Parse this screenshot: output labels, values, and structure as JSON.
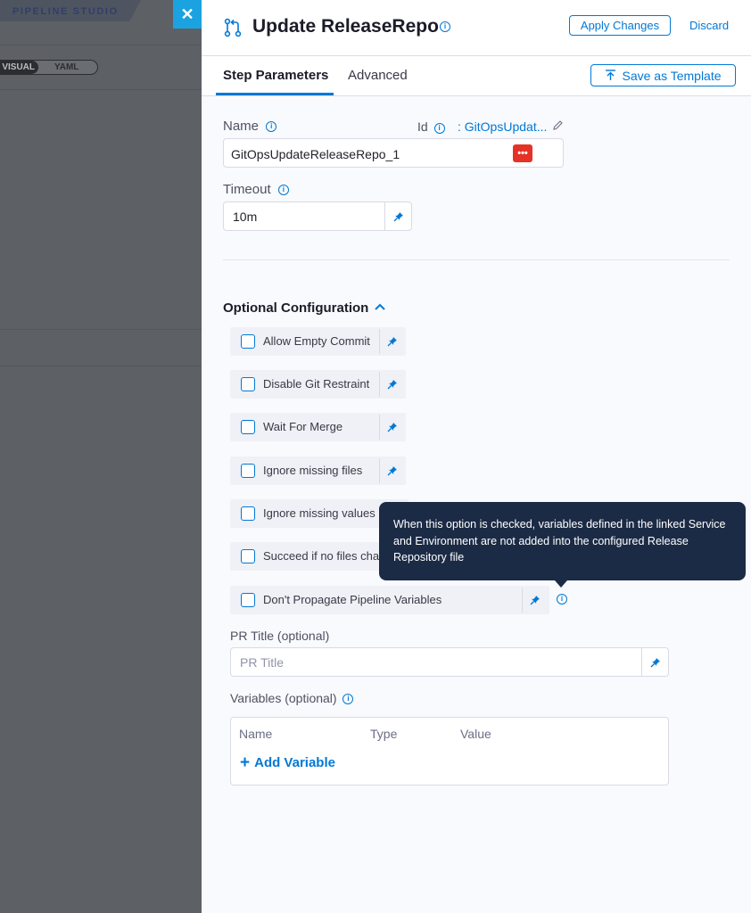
{
  "background": {
    "app_title": "PIPELINE STUDIO",
    "toggle_visual": "VISUAL",
    "toggle_yaml": "YAML"
  },
  "close_icon": "close-icon",
  "header": {
    "title": "Update ReleaseRepo",
    "apply_label": "Apply Changes",
    "discard_label": "Discard"
  },
  "tabs": {
    "items": [
      {
        "label": "Step Parameters",
        "active": true
      },
      {
        "label": "Advanced",
        "active": false
      }
    ],
    "save_template_label": "Save as Template"
  },
  "form": {
    "name_label": "Name",
    "id_label": "Id",
    "id_value": ": GitOpsUpdat...",
    "name_value": "GitOpsUpdateReleaseRepo_1",
    "timeout_label": "Timeout",
    "timeout_value": "10m"
  },
  "optional": {
    "title": "Optional Configuration",
    "checkboxes": [
      {
        "label": "Allow Empty Commit",
        "checked": false
      },
      {
        "label": "Disable Git Restraint",
        "checked": false
      },
      {
        "label": "Wait For Merge",
        "checked": false
      },
      {
        "label": "Ignore missing files",
        "checked": false
      },
      {
        "label": "Ignore missing values",
        "checked": false
      },
      {
        "label": "Succeed if no files cha",
        "checked": false
      },
      {
        "label": "Don't Propagate Pipeline Variables",
        "checked": false
      }
    ],
    "tooltip": "When this option is checked, variables defined in the linked Service and Environment are not added into the configured Release Repository file",
    "pr_title_label": "PR Title (optional)",
    "pr_title_placeholder": "PR Title",
    "variables_label": "Variables (optional)",
    "variables_columns": [
      "Name",
      "Type",
      "Value"
    ],
    "add_variable_label": "Add Variable"
  },
  "colors": {
    "accent": "#0278d5",
    "tooltip_bg": "#1c2b45",
    "close_bg": "#1aa3e0",
    "badge_red": "#e43326"
  }
}
